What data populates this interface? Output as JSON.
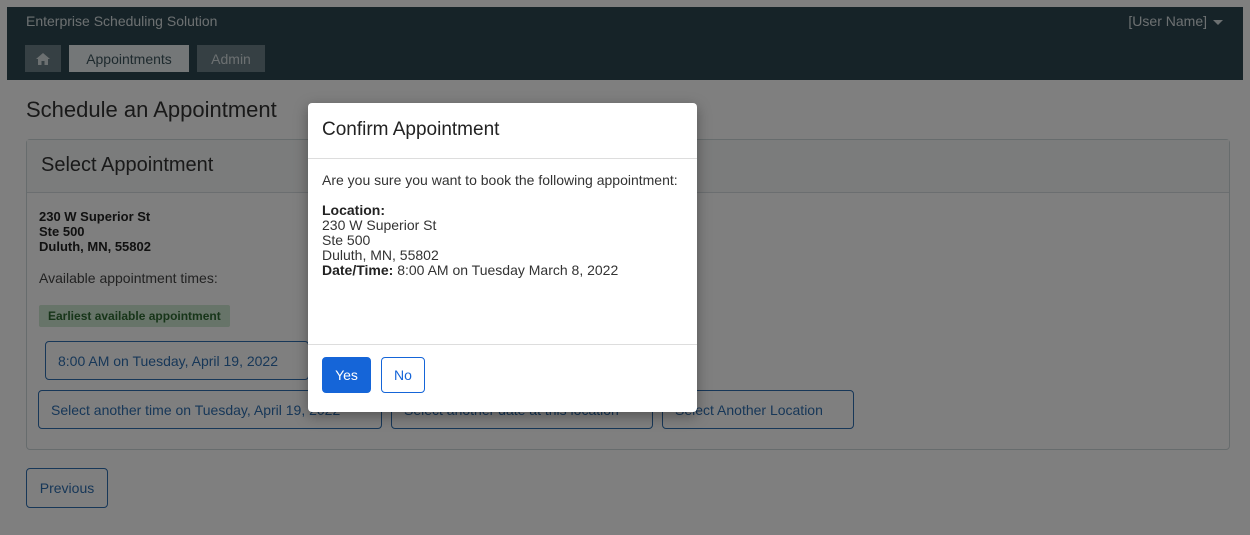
{
  "header": {
    "app_title": "Enterprise Scheduling Solution",
    "user_menu": "[User Name]"
  },
  "nav": {
    "home_icon": "home-icon",
    "tabs": [
      {
        "label": "Appointments",
        "active": true
      },
      {
        "label": "Admin",
        "active": false
      }
    ]
  },
  "page": {
    "title": "Schedule an Appointment",
    "panel_title": "Select Appointment",
    "address": [
      "230 W Superior St",
      "Ste 500",
      "Duluth, MN, 55802"
    ],
    "available_label": "Available appointment times:",
    "earliest_badge": "Earliest available appointment",
    "earliest_time_button": "8:00 AM on Tuesday, April 19, 2022",
    "other_time_button": "Select another time on Tuesday, April 19, 2022",
    "other_date_button": "Select another date at this location",
    "other_location_button": "Select  Another Location",
    "previous_button": "Previous"
  },
  "modal": {
    "title": "Confirm Appointment",
    "question": "Are you sure you want to book the following appointment:",
    "location_label": "Location:",
    "location_lines": [
      "230 W Superior St",
      "Ste 500",
      "Duluth, MN, 55802"
    ],
    "datetime_label": "Date/Time:",
    "datetime_value": " 8:00 AM on Tuesday March 8, 2022",
    "yes_button": "Yes",
    "no_button": "No"
  },
  "colors": {
    "header_bg": "#2c4650",
    "primary": "#1565d8",
    "badge_bg": "#cfe8d2"
  }
}
